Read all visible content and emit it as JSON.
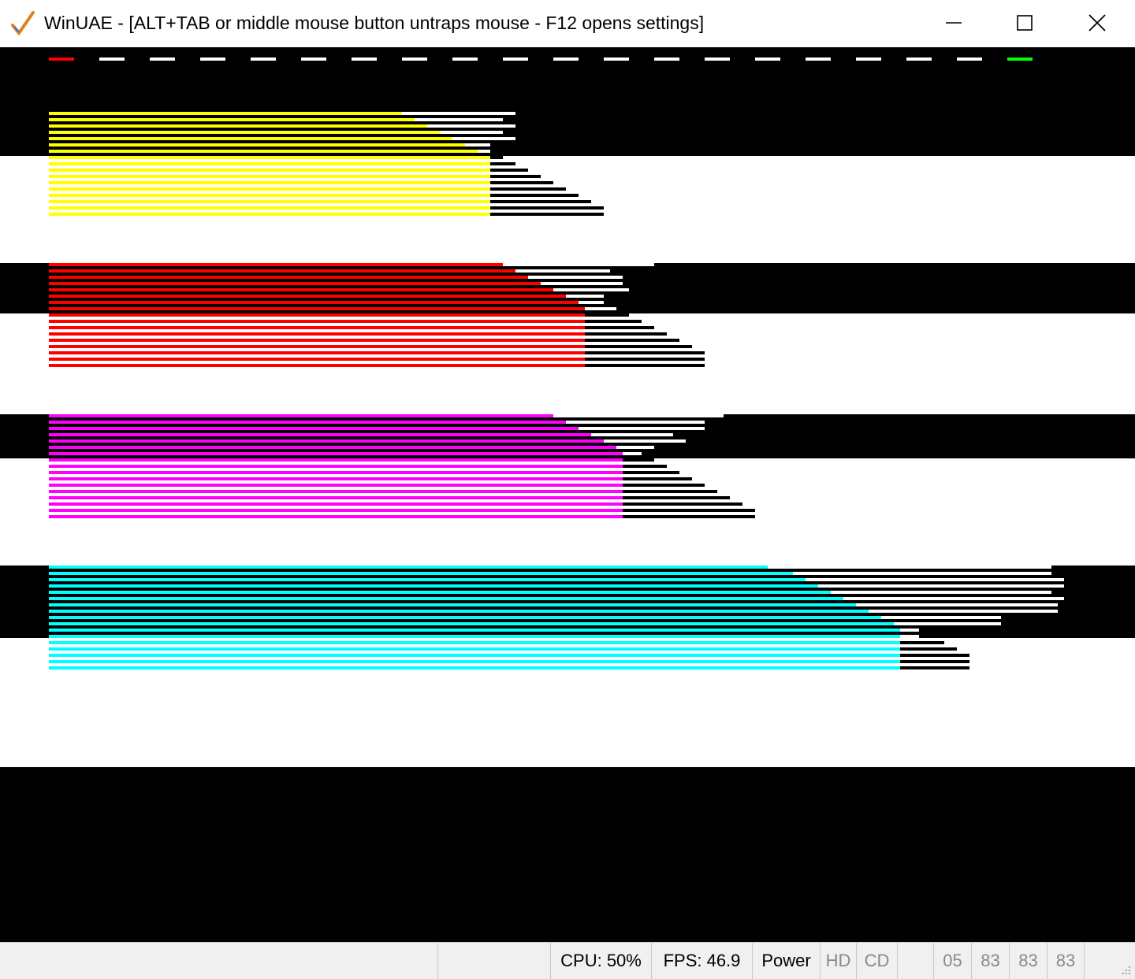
{
  "window": {
    "title": "WinUAE - [ALT+TAB or middle mouse button untraps mouse - F12 opens settings]"
  },
  "colors": {
    "bar_colors": [
      "#ffff00",
      "#ff0000",
      "#ff00ff",
      "#00ffff"
    ],
    "indicator_first": "#ff0000",
    "indicator_last": "#00ff00",
    "indicator_mid": "#ffffff"
  },
  "emulator_display": {
    "dash_count": 20,
    "bar_groups": [
      {
        "color": "yellow",
        "line_count": 17
      },
      {
        "color": "red",
        "line_count": 17
      },
      {
        "color": "magenta",
        "line_count": 17
      },
      {
        "color": "cyan",
        "line_count": 17
      }
    ]
  },
  "statusbar": {
    "cpu": "CPU: 50%",
    "fps": "FPS: 46.9",
    "power": "Power",
    "hd": "HD",
    "cd": "CD",
    "drives": [
      "05",
      "83",
      "83",
      "83"
    ]
  }
}
